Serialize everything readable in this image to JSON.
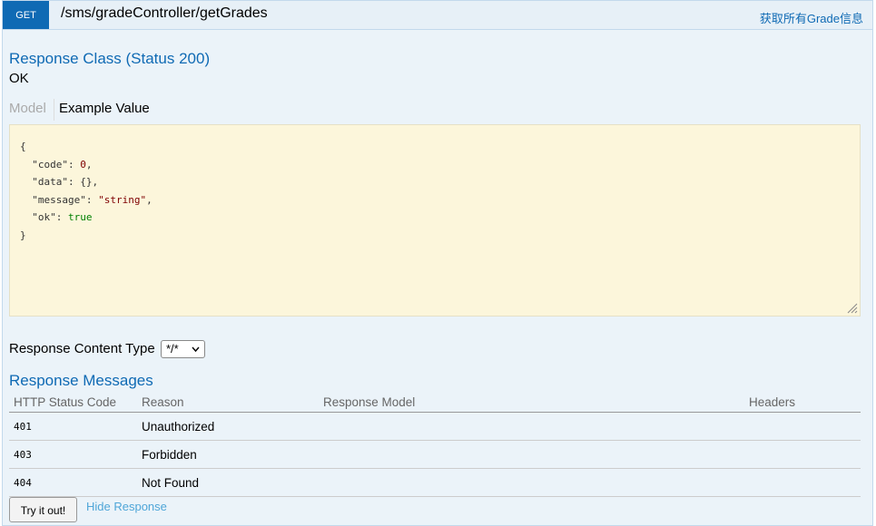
{
  "operation": {
    "method": "GET",
    "path": "/sms/gradeController/getGrades",
    "summary": "获取所有Grade信息"
  },
  "response_class": {
    "title": "Response Class (Status 200)",
    "description": "OK"
  },
  "signature_tabs": {
    "model_label": "Model",
    "example_label": "Example Value",
    "active": "Example Value"
  },
  "example_value": {
    "open_brace": "{",
    "close_brace": "}",
    "fields": [
      {
        "key": "\"code\"",
        "value": "0",
        "type": "number"
      },
      {
        "key": "\"data\"",
        "value": "{}",
        "type": "object"
      },
      {
        "key": "\"message\"",
        "value": "\"string\"",
        "type": "string"
      },
      {
        "key": "\"ok\"",
        "value": "true",
        "type": "boolean"
      }
    ]
  },
  "response_content_type": {
    "label": "Response Content Type",
    "selected": "*/*"
  },
  "response_messages": {
    "title": "Response Messages",
    "columns": [
      "HTTP Status Code",
      "Reason",
      "Response Model",
      "Headers"
    ],
    "rows": [
      {
        "code": "401",
        "reason": "Unauthorized",
        "model": "",
        "headers": ""
      },
      {
        "code": "403",
        "reason": "Forbidden",
        "model": "",
        "headers": ""
      },
      {
        "code": "404",
        "reason": "Not Found",
        "model": "",
        "headers": ""
      }
    ]
  },
  "actions": {
    "try_label": "Try it out!",
    "hide_label": "Hide Response"
  },
  "colors": {
    "get_method": "#0f6ab4",
    "link": "#0f6ab4",
    "example_bg": "#fcf6db"
  }
}
